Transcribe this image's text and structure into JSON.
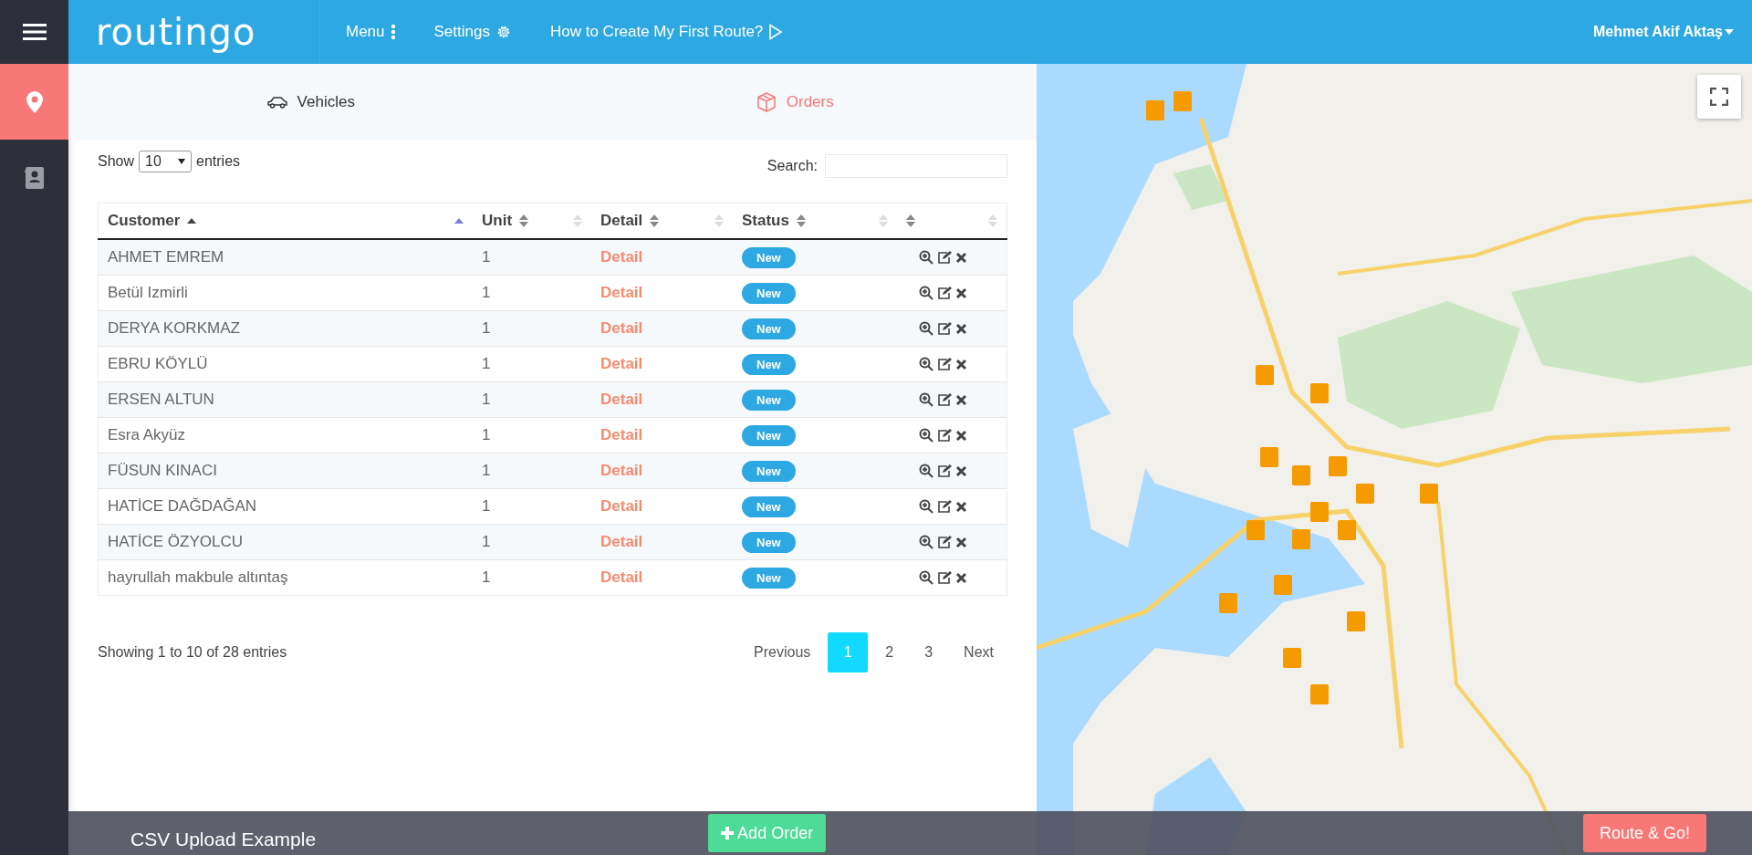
{
  "header": {
    "logo": "routingo",
    "nav": [
      {
        "label": "Menu",
        "kind": "more"
      },
      {
        "label": "Settings",
        "kind": "settings"
      },
      {
        "label": "How to Create My First Route?",
        "kind": "tutorial"
      }
    ],
    "user": "Mehmet Akif Aktaş"
  },
  "sidebar": {
    "items": [
      {
        "kind": "routes",
        "selected": true
      },
      {
        "kind": "contacts",
        "selected": false
      }
    ]
  },
  "tabs": [
    {
      "label": "Vehicles",
      "kind": "vehicles",
      "selected": false
    },
    {
      "label": "Orders",
      "kind": "orders",
      "selected": true
    }
  ],
  "table_controls": {
    "show_label": "Show",
    "page_size": "10",
    "entries_label": "entries",
    "search_label": "Search:"
  },
  "table": {
    "columns": [
      {
        "label": "Customer",
        "sorted": true
      },
      {
        "label": "Unit",
        "sorted": false
      },
      {
        "label": "Detail",
        "sorted": false
      },
      {
        "label": "Status",
        "sorted": false
      },
      {
        "sorted": false
      }
    ],
    "rows": [
      {
        "customer": "AHMET EMREM",
        "unit": "1",
        "detail": "Detail",
        "status": "New"
      },
      {
        "customer": "Betül Izmirli",
        "unit": "1",
        "detail": "Detail",
        "status": "New"
      },
      {
        "customer": "DERYA KORKMAZ",
        "unit": "1",
        "detail": "Detail",
        "status": "New"
      },
      {
        "customer": "EBRU KÖYLÜ",
        "unit": "1",
        "detail": "Detail",
        "status": "New"
      },
      {
        "customer": "ERSEN ALTUN",
        "unit": "1",
        "detail": "Detail",
        "status": "New"
      },
      {
        "customer": "Esra Akyüz",
        "unit": "1",
        "detail": "Detail",
        "status": "New"
      },
      {
        "customer": "FÜSUN KINACI",
        "unit": "1",
        "detail": "Detail",
        "status": "New"
      },
      {
        "customer": "HATİCE DAĞDAĞAN",
        "unit": "1",
        "detail": "Detail",
        "status": "New"
      },
      {
        "customer": "HATİCE ÖZYOLCU",
        "unit": "1",
        "detail": "Detail",
        "status": "New"
      },
      {
        "customer": "hayrullah makbule altıntaş",
        "unit": "1",
        "detail": "Detail",
        "status": "New"
      }
    ]
  },
  "info": "Showing 1 to 10 of 28 entries",
  "pagination": [
    {
      "label": "Previous",
      "selected": false
    },
    {
      "label": "1",
      "selected": true
    },
    {
      "label": "2",
      "selected": false
    },
    {
      "label": "3",
      "selected": false
    },
    {
      "label": "Next",
      "selected": false
    }
  ],
  "footer": {
    "csv_link": "CSV Upload Example",
    "add_button": "Add Order",
    "route_button": "Route & Go!"
  }
}
